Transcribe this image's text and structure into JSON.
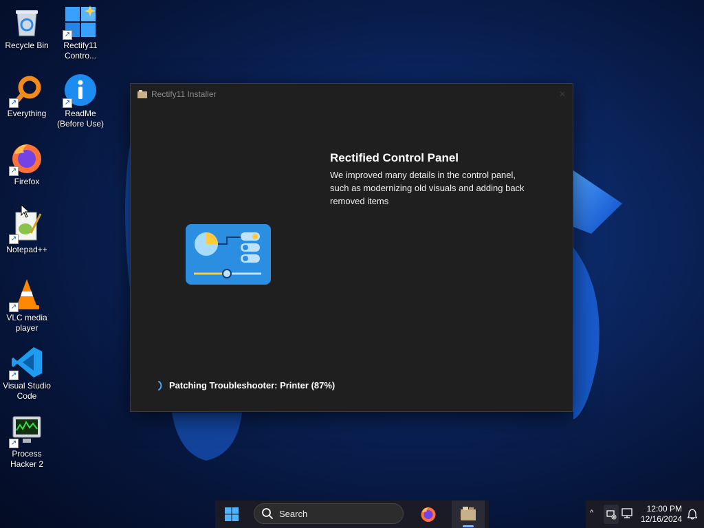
{
  "desktop": {
    "icons": [
      {
        "label": "Recycle Bin",
        "icon": "recycle-bin-icon",
        "shortcut": false
      },
      {
        "label": "Rectify11\nContro...",
        "icon": "rectify11-control-icon",
        "shortcut": true
      },
      {
        "label": "Everything",
        "icon": "everything-search-icon",
        "shortcut": true
      },
      {
        "label": "ReadMe\n(Before Use)",
        "icon": "info-icon",
        "shortcut": true
      },
      {
        "label": "Firefox",
        "icon": "firefox-icon",
        "shortcut": true
      },
      {
        "label": "Notepad++",
        "icon": "notepad-plus-plus-icon",
        "shortcut": true
      },
      {
        "label": "VLC media\nplayer",
        "icon": "vlc-cone-icon",
        "shortcut": true
      },
      {
        "label": "Visual Studio\nCode",
        "icon": "vscode-icon",
        "shortcut": true
      },
      {
        "label": "Process\nHacker 2",
        "icon": "process-hacker-icon",
        "shortcut": true
      }
    ]
  },
  "installer": {
    "title": "Rectify11 Installer",
    "close_glyph": "✕",
    "feature_title": "Rectified Control Panel",
    "feature_description": "We improved many details in the control panel, such as modernizing old visuals and adding back removed items",
    "status_text": "Patching Troubleshooter: Printer (87%)",
    "progress_percent": 87,
    "hero_icon": "control-panel-icon"
  },
  "taskbar": {
    "search_placeholder": "Search",
    "apps": [
      "start-icon",
      "firefox-icon",
      "rectify11-installer-icon"
    ],
    "tray_chevron": "^",
    "clock_time": "12:00 PM",
    "clock_date": "12/16/2024"
  },
  "colors": {
    "accent": "#0078d4",
    "window_bg": "#1f1f1f",
    "wallpaper": "#0b2660"
  }
}
